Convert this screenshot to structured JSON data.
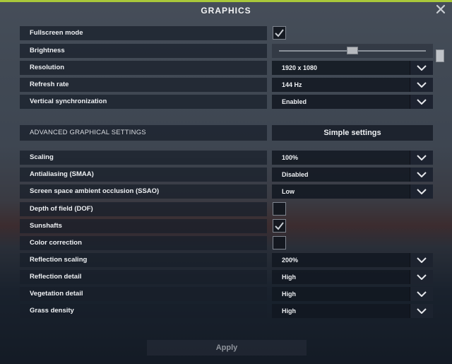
{
  "window": {
    "title": "GRAPHICS",
    "close_icon": "close-icon",
    "accent_color": "#a9c83a"
  },
  "settings": {
    "fullscreen": {
      "label": "Fullscreen mode",
      "checked": true
    },
    "brightness": {
      "label": "Brightness",
      "level": 0.5
    },
    "resolution": {
      "label": "Resolution",
      "value": "1920 x 1080"
    },
    "refresh_rate": {
      "label": "Refresh rate",
      "value": "144 Hz"
    },
    "vsync": {
      "label": "Vertical synchronization",
      "value": "Enabled"
    }
  },
  "advanced": {
    "heading": "ADVANCED GRAPHICAL SETTINGS",
    "simple_button": "Simple settings",
    "scaling": {
      "label": "Scaling",
      "value": "100%"
    },
    "antialiasing": {
      "label": "Antialiasing (SMAA)",
      "value": "Disabled"
    },
    "ssao": {
      "label": "Screen space ambient occlusion (SSAO)",
      "value": "Low"
    },
    "dof": {
      "label": "Depth of field (DOF)",
      "checked": false
    },
    "sunshafts": {
      "label": "Sunshafts",
      "checked": true
    },
    "color_correction": {
      "label": "Color correction",
      "checked": false
    },
    "reflection_scaling": {
      "label": "Reflection scaling",
      "value": "200%"
    },
    "reflection_detail": {
      "label": "Reflection detail",
      "value": "High"
    },
    "vegetation_detail": {
      "label": "Vegetation detail",
      "value": "High"
    },
    "grass_density": {
      "label": "Grass density",
      "value": "High"
    }
  },
  "footer": {
    "apply_label": "Apply"
  },
  "scrollbar": {
    "position": 0.0
  }
}
